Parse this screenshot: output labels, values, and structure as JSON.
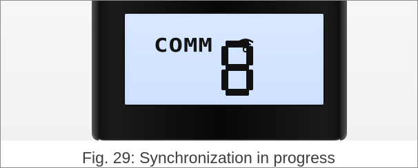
{
  "display": {
    "status_text": "COMM",
    "digit": "8",
    "signal_icon": "wireless-signal-icon"
  },
  "caption": {
    "text": "Fig. 29:  Synchronization in progress"
  }
}
